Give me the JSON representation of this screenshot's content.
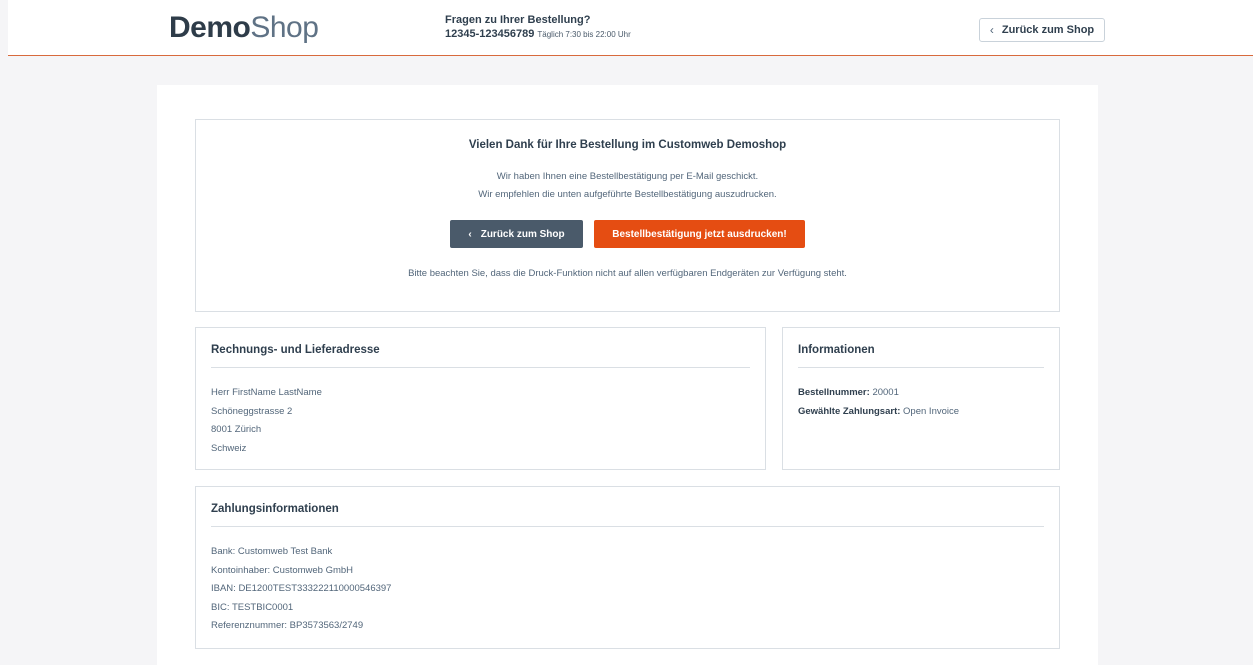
{
  "header": {
    "logo_bold": "Demo",
    "logo_light": "Shop",
    "contact_question": "Fragen zu Ihrer Bestellung?",
    "contact_phone": "12345-123456789",
    "contact_hours": "Täglich 7:30 bis 22:00 Uhr",
    "back_button_label": "Zurück zum Shop",
    "back_icon": "chevron-left-icon"
  },
  "thanks": {
    "title": "Vielen Dank für Ihre Bestellung im Customweb Demoshop",
    "line1": "Wir haben Ihnen eine Bestellbestätigung per E-Mail geschickt.",
    "line2": "Wir empfehlen die unten aufgeführte Bestellbestätigung auszudrucken.",
    "back_button_label": "Zurück zum Shop",
    "print_button_label": "Bestellbestätigung jetzt ausdrucken!",
    "note": "Bitte beachten Sie, dass die Druck-Funktion nicht auf allen verfügbaren Endgeräten zur Verfügung steht."
  },
  "address": {
    "title": "Rechnungs- und Lieferadresse",
    "name": "Herr FirstName LastName",
    "street": "Schöneggstrasse 2",
    "city": "8001 Zürich",
    "country": "Schweiz"
  },
  "info": {
    "title": "Informationen",
    "order_number_label": "Bestellnummer:",
    "order_number_value": "20001",
    "payment_method_label": "Gewählte Zahlungsart:",
    "payment_method_value": "Open Invoice"
  },
  "payment": {
    "title": "Zahlungsinformationen",
    "bank": "Bank: Customweb Test Bank",
    "account_holder": "Kontoinhaber: Customweb GmbH",
    "iban": "IBAN: DE1200TEST333222110000546397",
    "bic": "BIC: TESTBIC0001",
    "reference": "Referenznummer: BP3573563/2749"
  },
  "colors": {
    "accent_orange": "#e54d12",
    "dark_button": "#4a5a6a",
    "header_rule": "#d86a3c",
    "text": "#52667a",
    "heading": "#2f3f4e"
  }
}
